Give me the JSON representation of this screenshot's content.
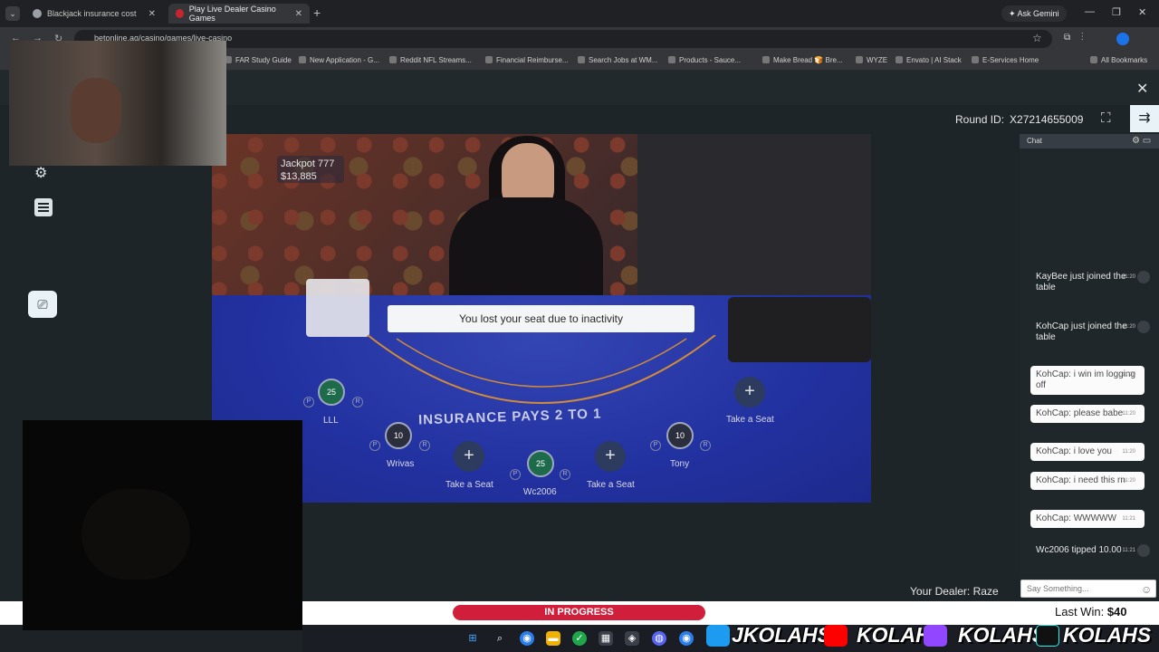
{
  "browser": {
    "tabs": [
      {
        "label": "Blackjack insurance cost"
      },
      {
        "label": "Play Live Dealer Casino Games"
      }
    ],
    "new_tab": "+",
    "gemini": "Ask Gemini",
    "url": "betonline.ag/casino/games/live-casino",
    "bookmarks": [
      "FAR Study Guide",
      "New Application - G...",
      "Reddit NFL Streams...",
      "Financial Reimburse...",
      "Search Jobs at WM...",
      "Products - Sauce...",
      "Make Bread 🍞 Bre...",
      "WYZE",
      "Envato | AI Stack",
      "E-Services Home",
      "All Bookmarks"
    ]
  },
  "game": {
    "round_label": "Round ID:",
    "round_id": "X27214655009",
    "jackpot_title": "Jackpot 777",
    "jackpot_value": "$13,885",
    "notice": "You lost your seat due to inactivity",
    "insurance_text": "INSURANCE PAYS 2 TO 1",
    "seats": [
      {
        "name": "LLL",
        "chip": "25"
      },
      {
        "name": "Wrivas",
        "chip": "10"
      },
      {
        "name": "Take a Seat"
      },
      {
        "name": "Wc2006",
        "chip": "25"
      },
      {
        "name": "Take a Seat"
      },
      {
        "name": "Tony",
        "chip": "10"
      },
      {
        "name": "Take a Seat"
      }
    ],
    "dealer_label": "Your Dealer: Raze",
    "status": "IN PROGRESS",
    "last_win_label": "Last Win:",
    "last_win_value": "$40"
  },
  "chat": {
    "title": "Chat",
    "placeholder": "Say Something...",
    "messages": [
      {
        "text": "KayBee just joined the table",
        "time": "11:20"
      },
      {
        "text": "KohCap just joined the table",
        "time": "11:20"
      },
      {
        "text": "KohCap: i win im logging off",
        "time": "11:20"
      },
      {
        "text": "KohCap: please babe",
        "time": "11:20"
      },
      {
        "text": "KohCap: i love you",
        "time": "11:20"
      },
      {
        "text": "KohCap: i need this rn",
        "time": "11:20"
      },
      {
        "text": "KohCap: WWWWW",
        "time": "11:21"
      },
      {
        "text": "Wc2006 tipped 10.00",
        "time": "11:21"
      }
    ]
  },
  "overlay": {
    "twitter": "JKOLAHS",
    "youtube": "KOLAH",
    "twitch": "KOLAHS",
    "tiktok": "KOLAHS"
  }
}
